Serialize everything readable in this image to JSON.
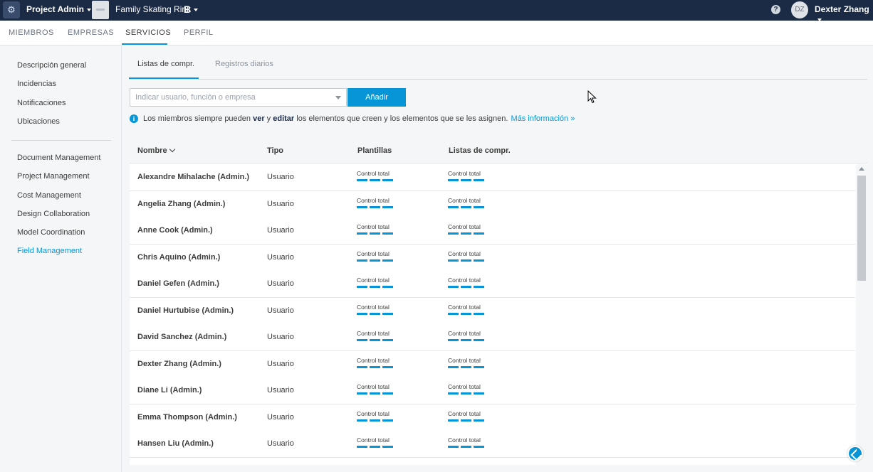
{
  "topbar": {
    "app_title": "Project Admin",
    "project_name": "Family Skating Rink",
    "brand_letter": "B",
    "help_glyph": "?",
    "avatar_initials": "DZ",
    "user_name": "Dexter Zhang"
  },
  "main_tabs": [
    {
      "label": "MIEMBROS",
      "active": false
    },
    {
      "label": "EMPRESAS",
      "active": false
    },
    {
      "label": "SERVICIOS",
      "active": true
    },
    {
      "label": "PERFIL",
      "active": false
    }
  ],
  "sidebar": {
    "group1": [
      "Descripción general",
      "Incidencias",
      "Notificaciones",
      "Ubicaciones"
    ],
    "group2": [
      "Document Management",
      "Project Management",
      "Cost Management",
      "Design Collaboration",
      "Model Coordination",
      "Field Management"
    ],
    "active_item": "Field Management"
  },
  "sub_tabs": [
    {
      "label": "Listas de compr.",
      "active": true
    },
    {
      "label": "Registros diarios",
      "active": false
    }
  ],
  "search": {
    "placeholder": "Indicar usuario, función o empresa"
  },
  "add_button": "Añadir",
  "info": {
    "prefix": "Los miembros siempre pueden ",
    "word_ver": "ver",
    "mid": " y ",
    "word_editar": "editar",
    "suffix": " los elementos que creen y los elementos que se les asignen.",
    "link": "Más información »"
  },
  "table": {
    "headers": {
      "name": "Nombre",
      "type": "Tipo",
      "templates": "Plantillas",
      "lists": "Listas de compr."
    },
    "rows": [
      {
        "name": "Alexandre Mihalache (Admin.)",
        "type": "Usuario",
        "templates": "Control total",
        "lists": "Control total"
      },
      {
        "name": "Angelia Zhang (Admin.)",
        "type": "Usuario",
        "templates": "Control total",
        "lists": "Control total"
      },
      {
        "name": "Anne Cook (Admin.)",
        "type": "Usuario",
        "templates": "Control total",
        "lists": "Control total"
      },
      {
        "name": "Chris Aquino (Admin.)",
        "type": "Usuario",
        "templates": "Control total",
        "lists": "Control total"
      },
      {
        "name": "Daniel Gefen (Admin.)",
        "type": "Usuario",
        "templates": "Control total",
        "lists": "Control total"
      },
      {
        "name": "Daniel Hurtubise (Admin.)",
        "type": "Usuario",
        "templates": "Control total",
        "lists": "Control total"
      },
      {
        "name": "David Sanchez (Admin.)",
        "type": "Usuario",
        "templates": "Control total",
        "lists": "Control total"
      },
      {
        "name": "Dexter Zhang (Admin.)",
        "type": "Usuario",
        "templates": "Control total",
        "lists": "Control total"
      },
      {
        "name": "Diane Li (Admin.)",
        "type": "Usuario",
        "templates": "Control total",
        "lists": "Control total"
      },
      {
        "name": "Emma Thompson (Admin.)",
        "type": "Usuario",
        "templates": "Control total",
        "lists": "Control total"
      },
      {
        "name": "Hansen Liu (Admin.)",
        "type": "Usuario",
        "templates": "Control total",
        "lists": "Control total"
      }
    ]
  },
  "colors": {
    "accent": "#0696d7",
    "topbar": "#1b2a45"
  }
}
